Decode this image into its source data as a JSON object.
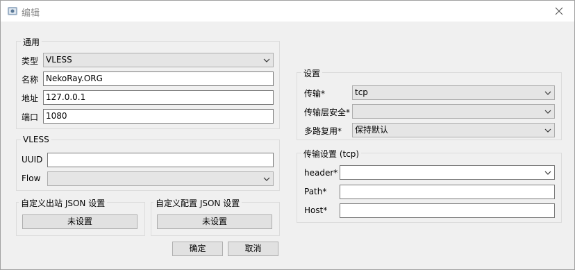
{
  "window": {
    "title": "编辑"
  },
  "general": {
    "title": "通用",
    "type_label": "类型",
    "type_value": "VLESS",
    "name_label": "名称",
    "name_value": "NekoRay.ORG",
    "address_label": "地址",
    "address_value": "127.0.0.1",
    "port_label": "端口",
    "port_value": "1080"
  },
  "vless": {
    "title": "VLESS",
    "uuid_label": "UUID",
    "uuid_value": "",
    "flow_label": "Flow",
    "flow_value": ""
  },
  "custom_outbound": {
    "title": "自定义出站 JSON 设置",
    "button": "未设置"
  },
  "custom_config": {
    "title": "自定义配置 JSON 设置",
    "button": "未设置"
  },
  "settings": {
    "title": "设置",
    "transport_label": "传输*",
    "transport_value": "tcp",
    "security_label": "传输层安全*",
    "security_value": "",
    "mux_label": "多路复用*",
    "mux_value": "保持默认"
  },
  "transport_settings": {
    "title": "传输设置 (tcp)",
    "header_label": "header*",
    "header_value": "",
    "path_label": "Path*",
    "path_value": "",
    "host_label": "Host*",
    "host_value": ""
  },
  "footer": {
    "ok_button": "确定",
    "cancel_button": "取消"
  },
  "icons": {
    "app": "app-logo-icon",
    "close": "close-icon",
    "dropdown": "chevron-down-icon"
  }
}
